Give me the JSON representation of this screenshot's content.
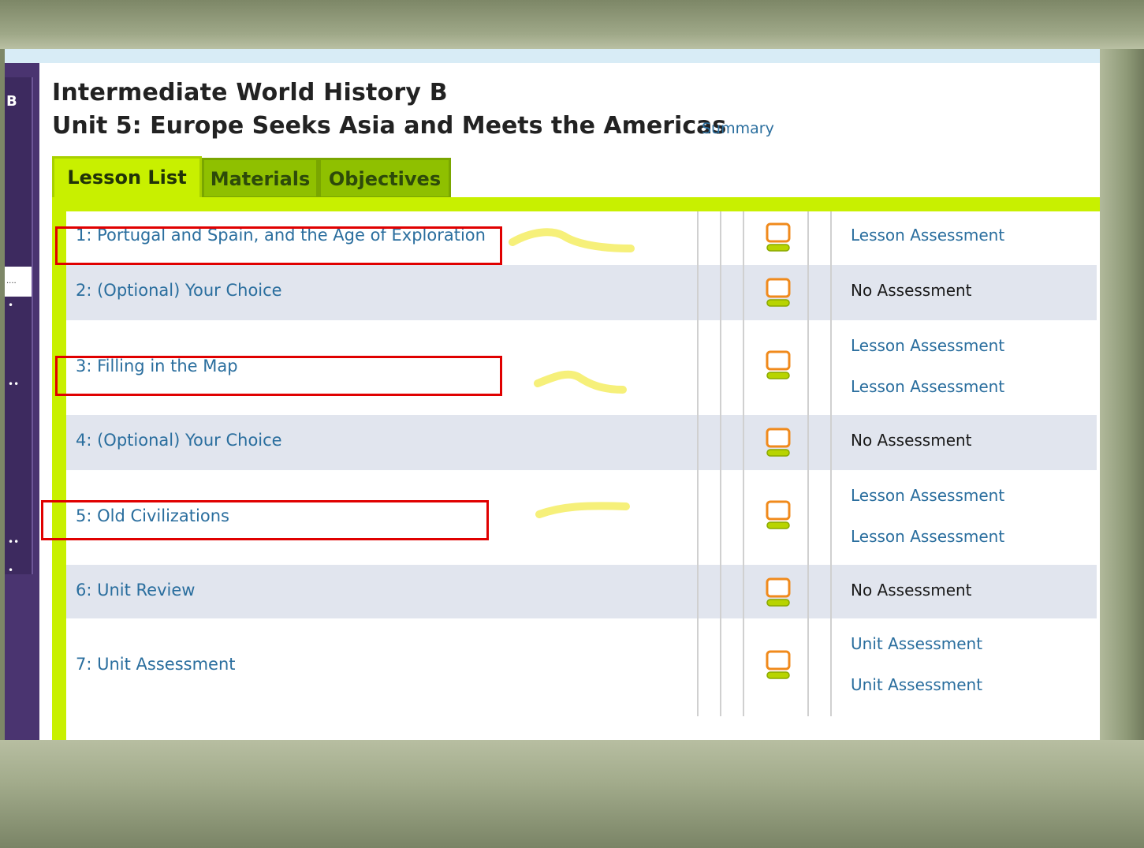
{
  "sidebar": {
    "letter": "B",
    "field_text": "...."
  },
  "header": {
    "course_title": "Intermediate World History B",
    "unit_title": "Unit 5: Europe Seeks Asia and Meets the Americas",
    "summary_link": "Summary"
  },
  "tabs": [
    {
      "label": "Lesson List",
      "active": true
    },
    {
      "label": "Materials",
      "active": false
    },
    {
      "label": "Objectives",
      "active": false
    }
  ],
  "lessons": [
    {
      "title": "1: Portugal and Spain, and the Age of Exploration",
      "assessments": [
        "Lesson Assessment"
      ],
      "assessment_type": "link"
    },
    {
      "title": "2: (Optional) Your Choice",
      "assessments": [
        "No Assessment"
      ],
      "assessment_type": "none"
    },
    {
      "title": "3: Filling in the Map",
      "assessments": [
        "Lesson Assessment",
        "Lesson Assessment"
      ],
      "assessment_type": "link"
    },
    {
      "title": "4: (Optional) Your Choice",
      "assessments": [
        "No Assessment"
      ],
      "assessment_type": "none"
    },
    {
      "title": "5: Old Civilizations",
      "assessments": [
        "Lesson Assessment",
        "Lesson Assessment"
      ],
      "assessment_type": "link"
    },
    {
      "title": "6: Unit Review",
      "assessments": [
        "No Assessment"
      ],
      "assessment_type": "none"
    },
    {
      "title": "7: Unit Assessment",
      "assessments": [
        "Unit Assessment",
        "Unit Assessment"
      ],
      "assessment_type": "link"
    }
  ],
  "icons": {
    "lesson_icon": "computer-icon"
  },
  "colors": {
    "tab_active": "#c8f000",
    "tab_inactive": "#8fc000",
    "link_blue": "#2a6e9e",
    "annotation_red": "#e00000",
    "annotation_yellow": "#f6f07a",
    "sidebar_purple": "#4a3470"
  }
}
